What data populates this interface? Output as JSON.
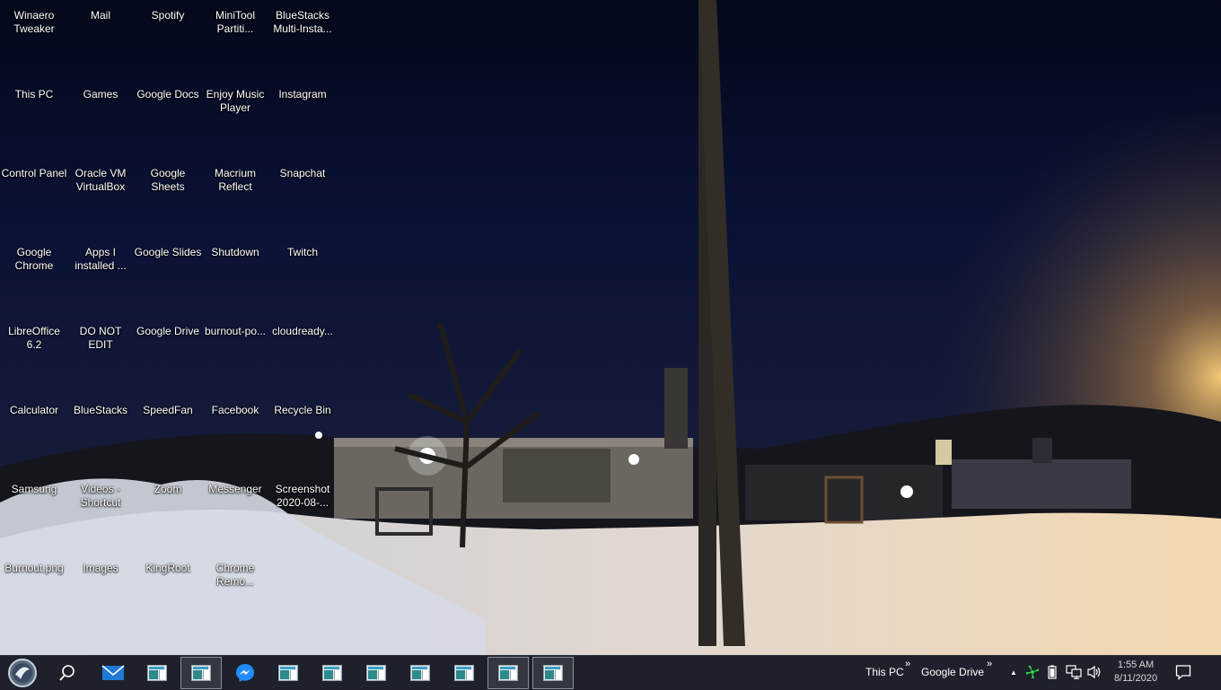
{
  "desktop": {
    "icons": [
      {
        "label": "Winaero Tweaker"
      },
      {
        "label": "This PC"
      },
      {
        "label": "Control Panel"
      },
      {
        "label": "Google Chrome"
      },
      {
        "label": "LibreOffice 6.2"
      },
      {
        "label": "Calculator"
      },
      {
        "label": "Samsung"
      },
      {
        "label": "Burnout.png"
      },
      {
        "label": "Mail"
      },
      {
        "label": "Games"
      },
      {
        "label": "Oracle VM VirtualBox"
      },
      {
        "label": "Apps I installed ..."
      },
      {
        "label": "DO NOT EDIT"
      },
      {
        "label": "BlueStacks"
      },
      {
        "label": "Videos - Shortcut"
      },
      {
        "label": "Images"
      },
      {
        "label": "Spotify"
      },
      {
        "label": "Google Docs"
      },
      {
        "label": "Google Sheets"
      },
      {
        "label": "Google Slides"
      },
      {
        "label": "Google Drive"
      },
      {
        "label": "SpeedFan"
      },
      {
        "label": "Zoom"
      },
      {
        "label": "KingRoot"
      },
      {
        "label": "MiniTool Partiti..."
      },
      {
        "label": "Enjoy Music Player"
      },
      {
        "label": "Macrium Reflect"
      },
      {
        "label": "Shutdown"
      },
      {
        "label": "burnout-po..."
      },
      {
        "label": "Facebook"
      },
      {
        "label": "Messenger"
      },
      {
        "label": "Chrome Remo..."
      },
      {
        "label": "BlueStacks Multi-Insta..."
      },
      {
        "label": "Instagram"
      },
      {
        "label": "Snapchat"
      },
      {
        "label": "Twitch"
      },
      {
        "label": "cloudready..."
      },
      {
        "label": "Recycle Bin"
      },
      {
        "label": "Screenshot 2020-08-..."
      }
    ]
  },
  "taskbar": {
    "start_icon": "start-orb-icon",
    "search_icon": "search-icon",
    "pinned": [
      {
        "icon": "mail-icon"
      },
      {
        "icon": "window-app-icon"
      },
      {
        "icon": "window-app-icon",
        "active": true
      },
      {
        "icon": "messenger-icon"
      },
      {
        "icon": "window-app-icon"
      },
      {
        "icon": "window-app-icon"
      },
      {
        "icon": "window-app-icon"
      },
      {
        "icon": "window-app-icon"
      },
      {
        "icon": "window-app-icon"
      },
      {
        "icon": "window-app-icon",
        "active": true
      },
      {
        "icon": "window-app-icon",
        "active": true
      }
    ],
    "toolbars": [
      {
        "label": "This PC",
        "chevron": "»"
      },
      {
        "label": "Google Drive",
        "chevron": "»"
      }
    ],
    "tray": {
      "overflow_chevron": "▲",
      "clock_time": "1:55 AM",
      "clock_date": "8/11/2020"
    }
  }
}
